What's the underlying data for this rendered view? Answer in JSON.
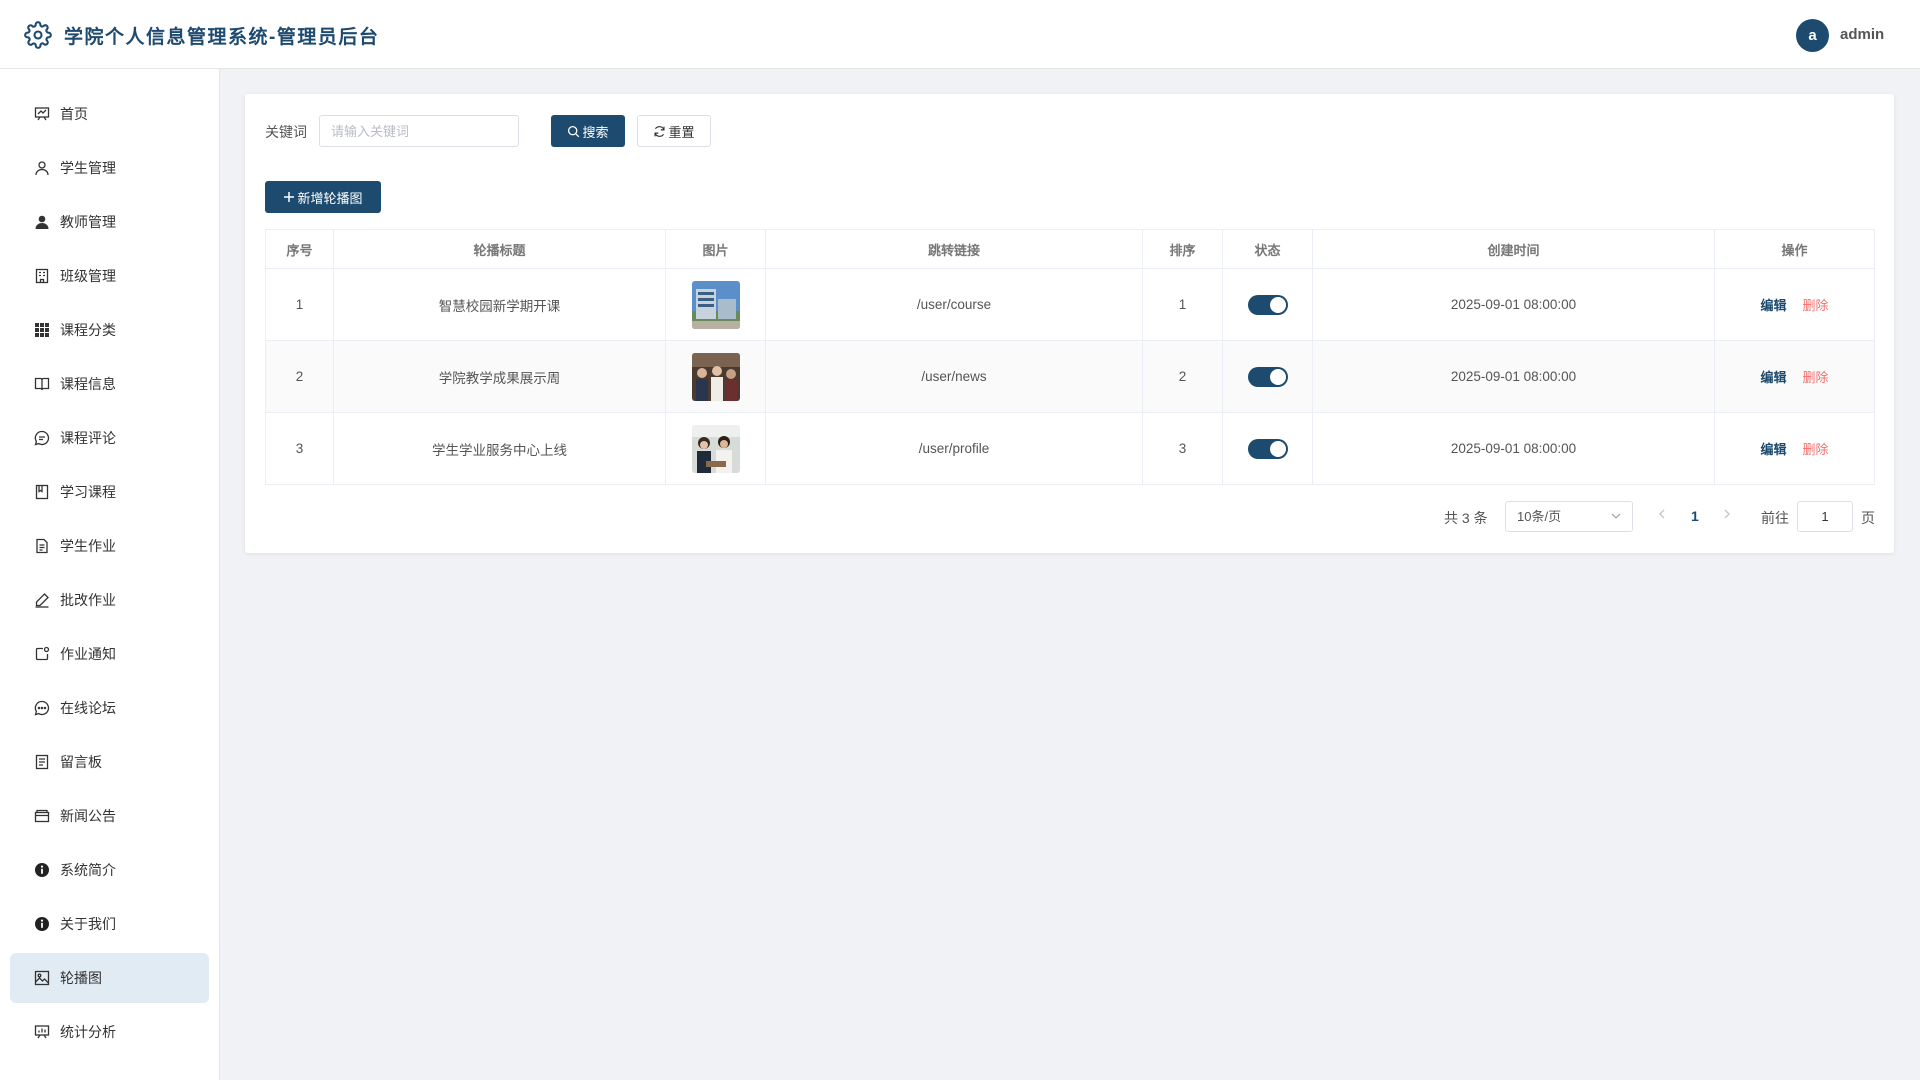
{
  "header": {
    "title": "学院个人信息管理系统-管理员后台",
    "avatar_letter": "a",
    "username": "admin"
  },
  "sidebar": {
    "items": [
      {
        "label": "首页",
        "icon": "presentation-icon"
      },
      {
        "label": "学生管理",
        "icon": "user-outline-icon"
      },
      {
        "label": "教师管理",
        "icon": "user-filled-icon"
      },
      {
        "label": "班级管理",
        "icon": "building-icon"
      },
      {
        "label": "课程分类",
        "icon": "grid-icon"
      },
      {
        "label": "课程信息",
        "icon": "book-icon"
      },
      {
        "label": "课程评论",
        "icon": "comment-icon"
      },
      {
        "label": "学习课程",
        "icon": "notebook-icon"
      },
      {
        "label": "学生作业",
        "icon": "document-icon"
      },
      {
        "label": "批改作业",
        "icon": "edit-pen-icon"
      },
      {
        "label": "作业通知",
        "icon": "notice-icon"
      },
      {
        "label": "在线论坛",
        "icon": "chat-dots-icon"
      },
      {
        "label": "留言板",
        "icon": "tickets-icon"
      },
      {
        "label": "新闻公告",
        "icon": "wallet-icon"
      },
      {
        "label": "系统简介",
        "icon": "info-filled-icon"
      },
      {
        "label": "关于我们",
        "icon": "info-filled-icon"
      },
      {
        "label": "轮播图",
        "icon": "picture-icon",
        "active": true
      },
      {
        "label": "统计分析",
        "icon": "data-board-icon"
      }
    ]
  },
  "search": {
    "label": "关键词",
    "placeholder": "请输入关键词",
    "value": "",
    "search_button": "搜索",
    "reset_button": "重置"
  },
  "toolbar": {
    "add_button": "新增轮播图"
  },
  "table": {
    "headers": [
      "序号",
      "轮播标题",
      "图片",
      "跳转链接",
      "排序",
      "状态",
      "创建时间",
      "操作"
    ],
    "rows": [
      {
        "index": "1",
        "title": "智慧校园新学期开课",
        "link": "/user/course",
        "sort": "1",
        "enabled": true,
        "created": "2025-09-01 08:00:00"
      },
      {
        "index": "2",
        "title": "学院教学成果展示周",
        "link": "/user/news",
        "sort": "2",
        "enabled": true,
        "created": "2025-09-01 08:00:00"
      },
      {
        "index": "3",
        "title": "学生学业服务中心上线",
        "link": "/user/profile",
        "sort": "3",
        "enabled": true,
        "created": "2025-09-01 08:00:00"
      }
    ],
    "edit_label": "编辑",
    "delete_label": "删除"
  },
  "pagination": {
    "total": "共 3 条",
    "page_size": "10条/页",
    "current_page": "1",
    "goto_label": "前往",
    "goto_value": "1",
    "page_suffix": "页"
  },
  "colors": {
    "primary": "#1d4b6f",
    "danger": "#f56c6c",
    "active_bg": "#e1ebf4"
  }
}
